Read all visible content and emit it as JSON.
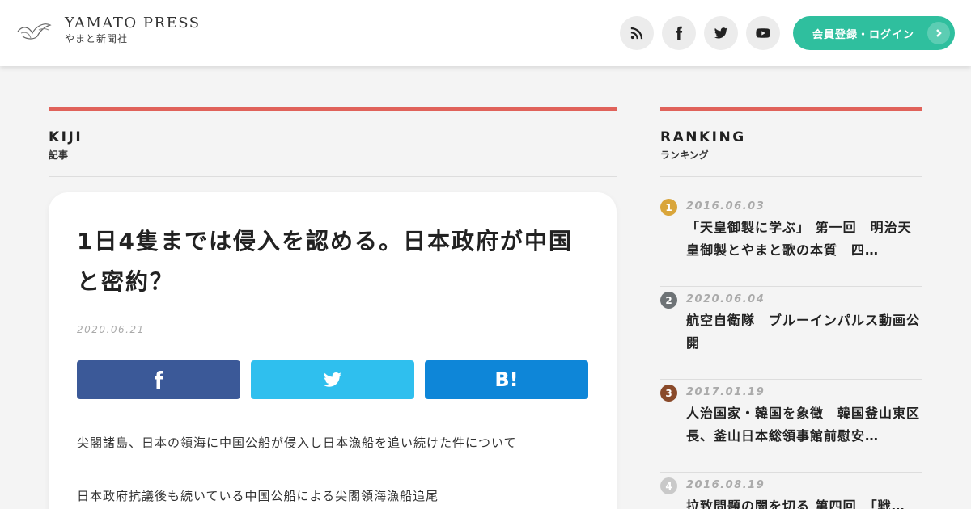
{
  "header": {
    "logo_en": "YAMATO PRESS",
    "logo_ja": "やまと新聞社",
    "login_label": "会員登録・ログイン"
  },
  "icons": {
    "rss": "rss-icon",
    "facebook": "facebook-icon",
    "twitter": "twitter-icon",
    "youtube": "youtube-icon",
    "chevron": "chevron-right-icon"
  },
  "colors": {
    "accent": "#e0625a",
    "login": "#2fbf9e",
    "facebook": "#3b5998",
    "twitter": "#2fbfee",
    "hatena": "#0e86d8"
  },
  "kiji": {
    "en": "KIJI",
    "ja": "記事"
  },
  "ranking_head": {
    "en": "RANKING",
    "ja": "ランキング"
  },
  "article": {
    "title": "1日4隻までは侵入を認める。日本政府が中国と密約？",
    "date": "2020.06.21",
    "hatena_label": "B!",
    "paragraphs": [
      "尖閣諸島、日本の領海に中国公船が侵入し日本漁船を追い続けた件について",
      "日本政府抗議後も続いている中国公船による尖閣領海漁船追尾"
    ]
  },
  "ranking": [
    {
      "rank": "1",
      "date": "2016.06.03",
      "title": "「天皇御製に学ぶ」 第一回　明治天皇御製とやまと歌の本質　四…",
      "color": "#d9a53a"
    },
    {
      "rank": "2",
      "date": "2020.06.04",
      "title": "航空自衛隊　ブルーインパルス動画公開",
      "color": "#6e7376"
    },
    {
      "rank": "3",
      "date": "2017.01.19",
      "title": "人治国家・韓国を象徴　韓国釜山東区長、釜山日本総領事館前慰安…",
      "color": "#8a4a2a"
    },
    {
      "rank": "4",
      "date": "2016.08.19",
      "title": "拉致問題の闇を切る 第四回　「戦…",
      "color": "#c9c9c9"
    }
  ]
}
